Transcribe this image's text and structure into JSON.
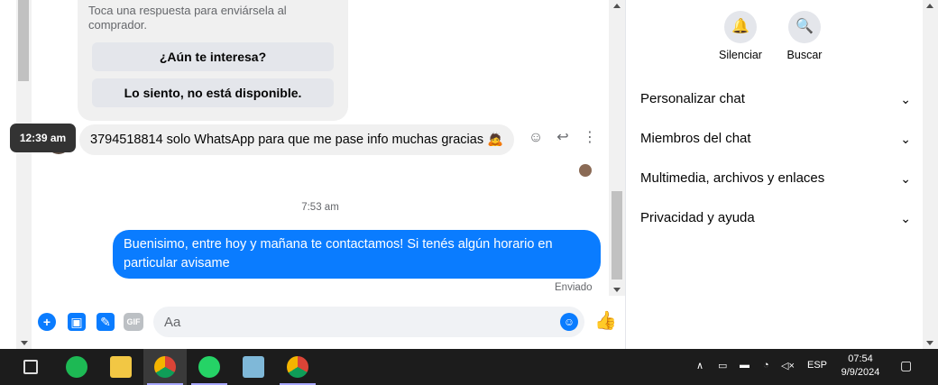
{
  "chat": {
    "quick_reply_hint": "Toca una respuesta para enviársela al comprador.",
    "quick_replies": [
      "¿Aún te interesa?",
      "Lo siento, no está disponible."
    ],
    "incoming_time_tooltip": "12:39 am",
    "incoming_message": "3794518814 solo WhatsApp para que me pase info muchas gracias 🙇",
    "separator_time": "7:53 am",
    "outgoing_message": "Buenisimo, entre hoy y mañana te contactamos! Si tenés algún horario en particular avisame",
    "outgoing_status": "Enviado"
  },
  "composer": {
    "placeholder": "Aa",
    "gif_label": "GIF"
  },
  "panel": {
    "actions": [
      {
        "label": "Silenciar",
        "icon": "bell-icon"
      },
      {
        "label": "Buscar",
        "icon": "search-icon"
      }
    ],
    "sections": [
      "Personalizar chat",
      "Miembros del chat",
      "Multimedia, archivos y enlaces",
      "Privacidad y ayuda"
    ]
  },
  "taskbar": {
    "apps": [
      "task-view",
      "spotify",
      "file-explorer",
      "chrome",
      "whatsapp",
      "notepad",
      "chrome-profile"
    ],
    "language": "ESP",
    "time": "07:54",
    "date": "9/9/2024"
  },
  "colors": {
    "accent": "#0a7cff",
    "bubble_in": "#f0f0f0",
    "taskbar": "#1c1c1c"
  }
}
